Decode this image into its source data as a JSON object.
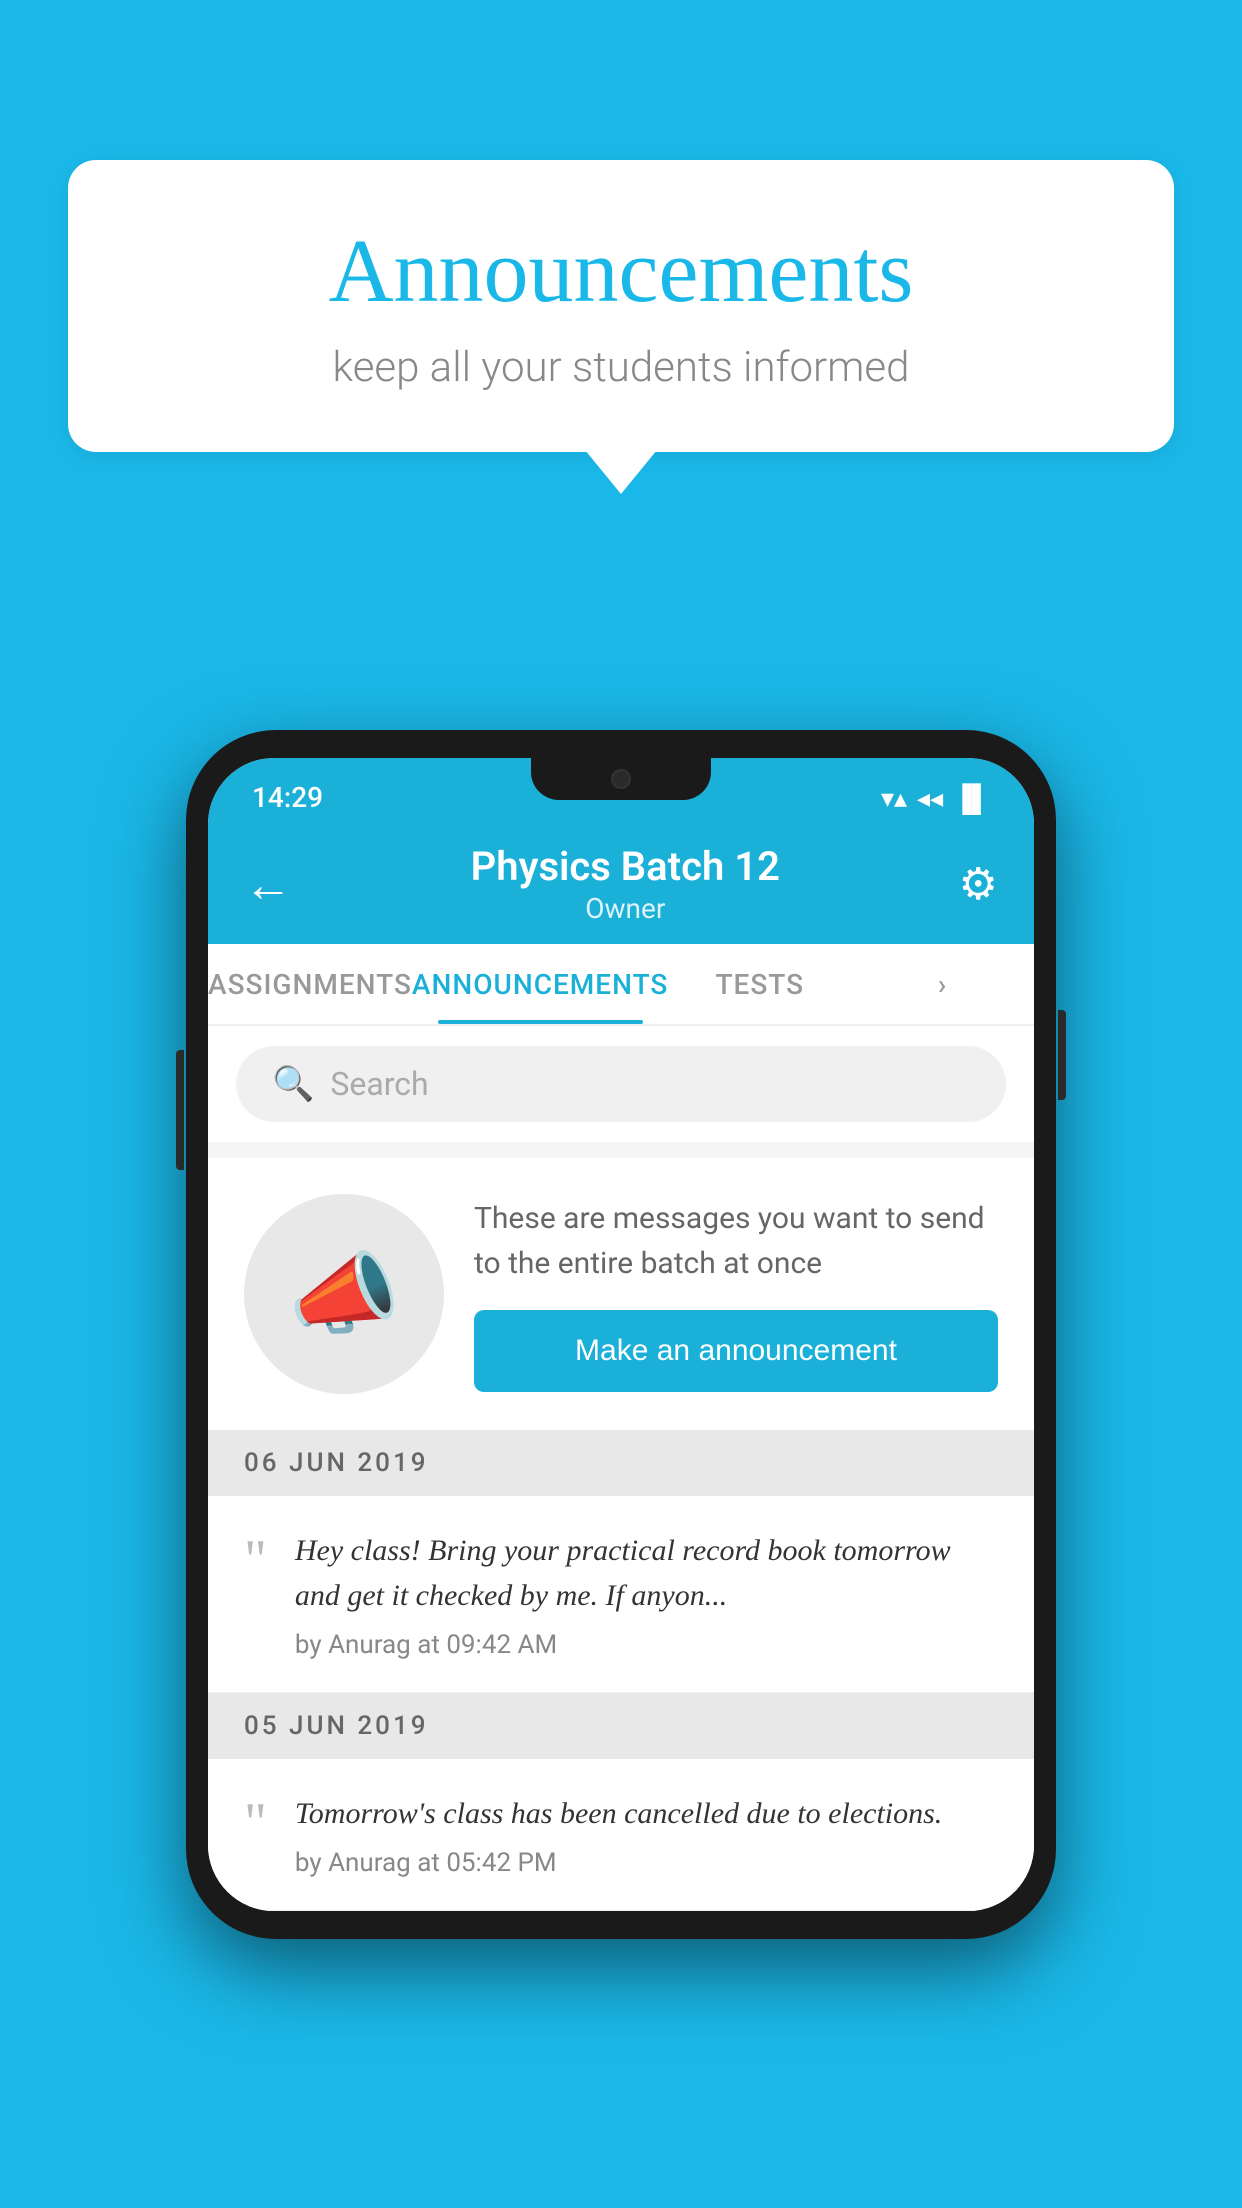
{
  "background_color": "#1ab8e8",
  "speech_bubble": {
    "title": "Announcements",
    "subtitle": "keep all your students informed"
  },
  "phone": {
    "status_bar": {
      "time": "14:29",
      "wifi": "▼",
      "signal": "◀",
      "battery": "▐"
    },
    "app_bar": {
      "title": "Physics Batch 12",
      "subtitle": "Owner",
      "back_label": "←",
      "gear_label": "⚙"
    },
    "tabs": [
      {
        "label": "ASSIGNMENTS",
        "active": false
      },
      {
        "label": "ANNOUNCEMENTS",
        "active": true
      },
      {
        "label": "TESTS",
        "active": false
      },
      {
        "label": "...",
        "active": false
      }
    ],
    "search": {
      "placeholder": "Search",
      "icon": "🔍"
    },
    "promo": {
      "description": "These are messages you want to send to the entire batch at once",
      "button_label": "Make an announcement"
    },
    "announcements": [
      {
        "date": "06  JUN  2019",
        "text": "Hey class! Bring your practical record book tomorrow and get it checked by me. If anyon...",
        "meta": "by Anurag at 09:42 AM"
      },
      {
        "date": "05  JUN  2019",
        "text": "Tomorrow's class has been cancelled due to elections.",
        "meta": "by Anurag at 05:42 PM"
      }
    ]
  }
}
